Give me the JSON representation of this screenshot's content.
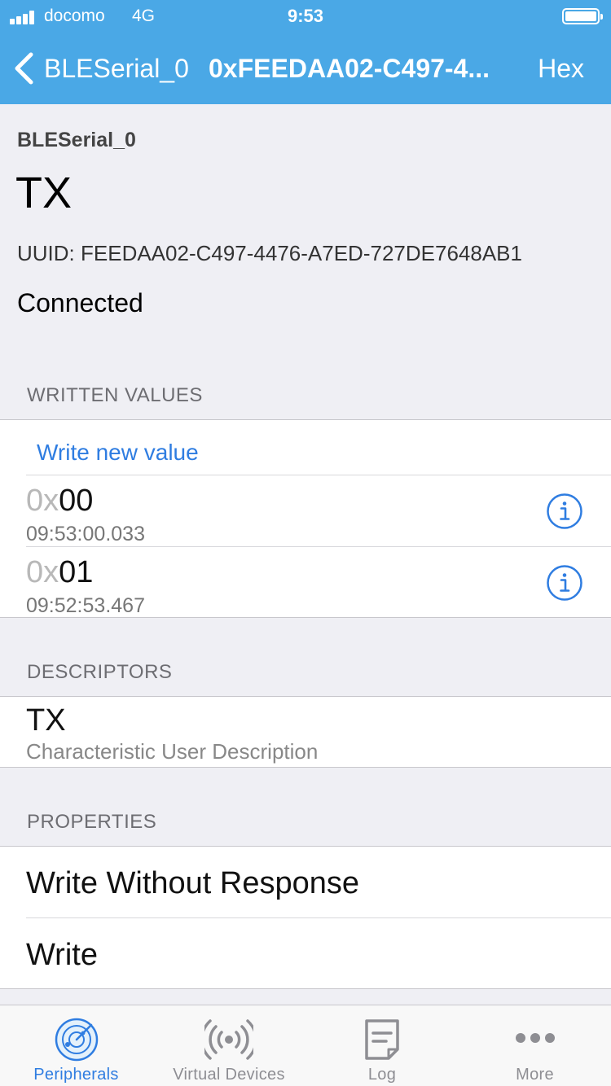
{
  "status_bar": {
    "carrier": "docomo",
    "network": "4G",
    "time": "9:53"
  },
  "nav": {
    "back_label": "BLESerial_0",
    "title": "0xFEEDAA02-C497-4...",
    "right_label": "Hex"
  },
  "header": {
    "peripheral_name": "BLESerial_0",
    "characteristic_name": "TX",
    "uuid": "UUID: FEEDAA02-C497-4476-A7ED-727DE7648AB1",
    "connection_status": "Connected"
  },
  "written_values": {
    "section_title": "WRITTEN VALUES",
    "write_new_label": "Write new value",
    "items": [
      {
        "prefix": "0x",
        "value": "00",
        "timestamp": "09:53:00.033"
      },
      {
        "prefix": "0x",
        "value": "01",
        "timestamp": "09:52:53.467"
      }
    ]
  },
  "descriptors": {
    "section_title": "DESCRIPTORS",
    "items": [
      {
        "title": "TX",
        "subtitle": "Characteristic User Description"
      }
    ]
  },
  "properties": {
    "section_title": "PROPERTIES",
    "items": [
      "Write Without Response",
      "Write"
    ]
  },
  "tabbar": {
    "tabs": [
      {
        "label": "Peripherals",
        "icon": "radar-icon",
        "active": true
      },
      {
        "label": "Virtual Devices",
        "icon": "broadcast-icon",
        "active": false
      },
      {
        "label": "Log",
        "icon": "log-icon",
        "active": false
      },
      {
        "label": "More",
        "icon": "more-icon",
        "active": false
      }
    ]
  },
  "colors": {
    "nav_bar": "#4aa8e6",
    "accent": "#2f7de1",
    "background": "#efeff4"
  }
}
